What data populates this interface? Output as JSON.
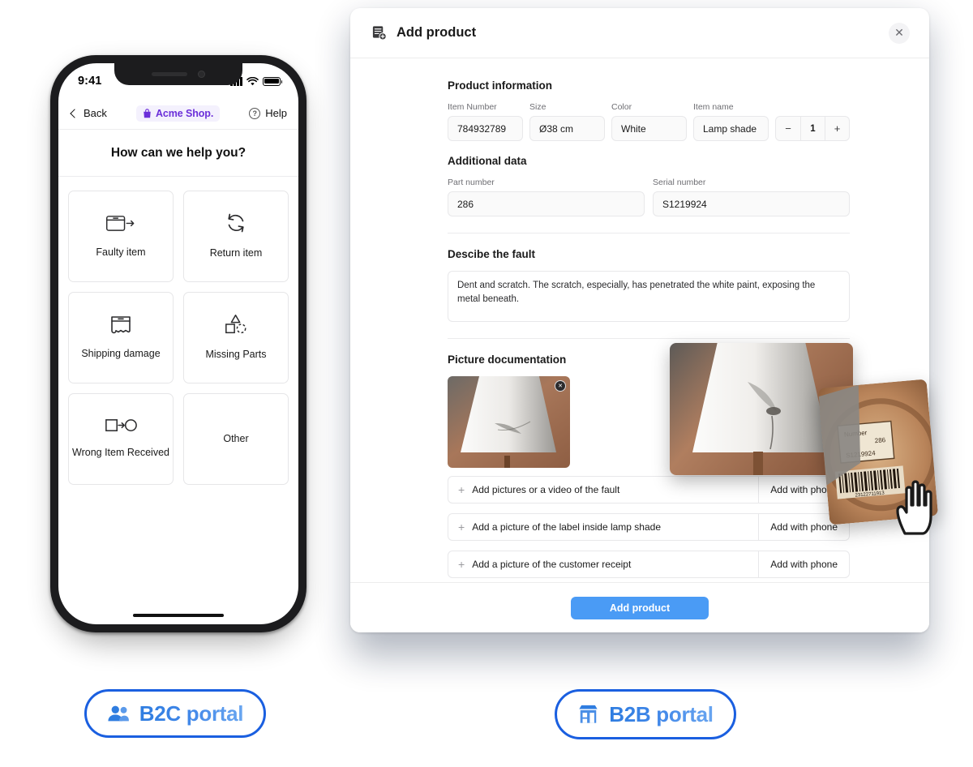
{
  "phone": {
    "status": {
      "time": "9:41",
      "signal_icon": "cellular-bars-icon",
      "wifi_icon": "wifi-icon",
      "battery_icon": "battery-icon"
    },
    "nav": {
      "back_label": "Back",
      "back_icon": "chevron-left-icon",
      "brand_label": "Acme Shop.",
      "brand_icon": "shopping-bag-icon",
      "brand_color": "#6b2fd9",
      "help_label": "Help",
      "help_icon": "question-circle-icon"
    },
    "title": "How can we help you?",
    "tiles": [
      {
        "label": "Faulty item",
        "icon": "box-arrow-out-icon"
      },
      {
        "label": "Return item",
        "icon": "return-arrows-icon"
      },
      {
        "label": "Shipping damage",
        "icon": "damaged-box-icon"
      },
      {
        "label": "Missing Parts",
        "icon": "shapes-missing-icon"
      },
      {
        "label": "Wrong Item Received",
        "icon": "square-arrow-circle-icon"
      },
      {
        "label": "Other",
        "icon": ""
      }
    ]
  },
  "modal": {
    "title": "Add product",
    "title_icon": "document-add-icon",
    "close_icon": "close-icon",
    "product_information": {
      "heading": "Product information",
      "fields": [
        {
          "label": "Item Number",
          "value": "784932789"
        },
        {
          "label": "Size",
          "value": "Ø38 cm"
        },
        {
          "label": "Color",
          "value": "White"
        },
        {
          "label": "Item name",
          "value": "Lamp shade"
        }
      ],
      "quantity": {
        "value": "1",
        "minus_icon": "minus-icon",
        "plus_icon": "plus-icon"
      }
    },
    "additional_data": {
      "heading": "Additional data",
      "fields": [
        {
          "label": "Part number",
          "value": "286"
        },
        {
          "label": "Serial number",
          "value": "S1219924"
        }
      ]
    },
    "fault": {
      "heading": "Descibe the fault",
      "text": "Dent and scratch. The scratch, especially, has penetrated the white paint, exposing the metal beneath."
    },
    "pictures": {
      "heading": "Picture documentation",
      "thumb_remove_icon": "remove-photo-icon",
      "rows": [
        {
          "label": "Add pictures or a video of the fault",
          "action": "Add with phone",
          "icon": "plus-icon"
        },
        {
          "label": "Add a picture of the label inside lamp shade",
          "action": "Add with phone",
          "icon": "plus-icon"
        },
        {
          "label": "Add a picture of the customer receipt",
          "action": "Add with phone",
          "icon": "plus-icon"
        }
      ]
    },
    "submit_label": "Add product",
    "submit_color": "#4a9bf5"
  },
  "floating": {
    "lamp_photo_alt": "dented lamp shade close-up",
    "label_photo_alt": "lamp shade inside label with barcode",
    "label_photo_text": {
      "number_label": "Number",
      "number_value": "286",
      "serial": "S1219924",
      "barcode_digits": "23122711913"
    },
    "cursor_icon": "hand-cursor-icon"
  },
  "badges": [
    {
      "id": "b2c",
      "label": "B2C portal",
      "icon": "people-icon",
      "border_color": "#1a5fe0"
    },
    {
      "id": "b2b",
      "label": "B2B portal",
      "icon": "store-building-icon",
      "border_color": "#1a5fe0"
    }
  ]
}
